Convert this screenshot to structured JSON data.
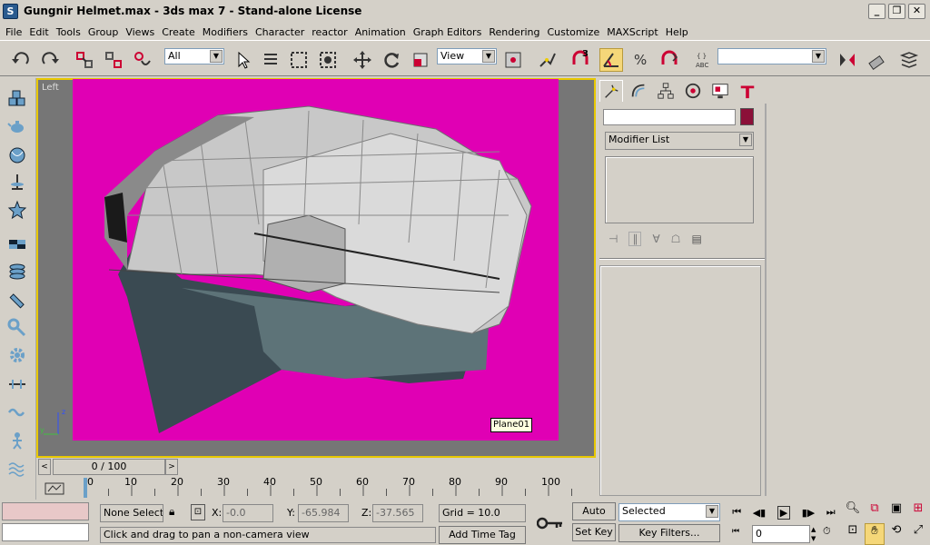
{
  "window": {
    "title": "Gungnir Helmet.max - 3ds max 7  - Stand-alone License",
    "app_icon": "3ds-max-icon",
    "minimize": "_",
    "maximize": "❐",
    "close": "✕"
  },
  "menu": [
    "File",
    "Edit",
    "Tools",
    "Group",
    "Views",
    "Create",
    "Modifiers",
    "Character",
    "reactor",
    "Animation",
    "Graph Editors",
    "Rendering",
    "Customize",
    "MAXScript",
    "Help"
  ],
  "toolbar": {
    "selection_filter": "All",
    "ref_coord": "View",
    "named_selection": "",
    "snap_spinner": "3"
  },
  "viewport": {
    "label": "Left",
    "object_label": "Plane01",
    "background_color": "#e000b4"
  },
  "command_panel": {
    "object_name": "",
    "object_color": "#8b1038",
    "modifier_list": "Modifier List"
  },
  "timeline": {
    "slider_label": "0 / 100",
    "ticks": [
      "0",
      "10",
      "20",
      "30",
      "40",
      "50",
      "60",
      "70",
      "80",
      "90",
      "100"
    ]
  },
  "status": {
    "selection": "None Selecte",
    "x_label": "X:",
    "x_value": "-0.0",
    "y_label": "Y:",
    "y_value": "-65.984",
    "z_label": "Z:",
    "z_value": "-37.565",
    "grid": "Grid = 10.0",
    "prompt": "Click and drag to pan a non-camera view",
    "add_time_tag": "Add Time Tag",
    "auto_key": "Auto Key",
    "set_key": "Set Key",
    "key_mode": "Selected",
    "key_filters": "Key Filters...",
    "frame": "0"
  }
}
